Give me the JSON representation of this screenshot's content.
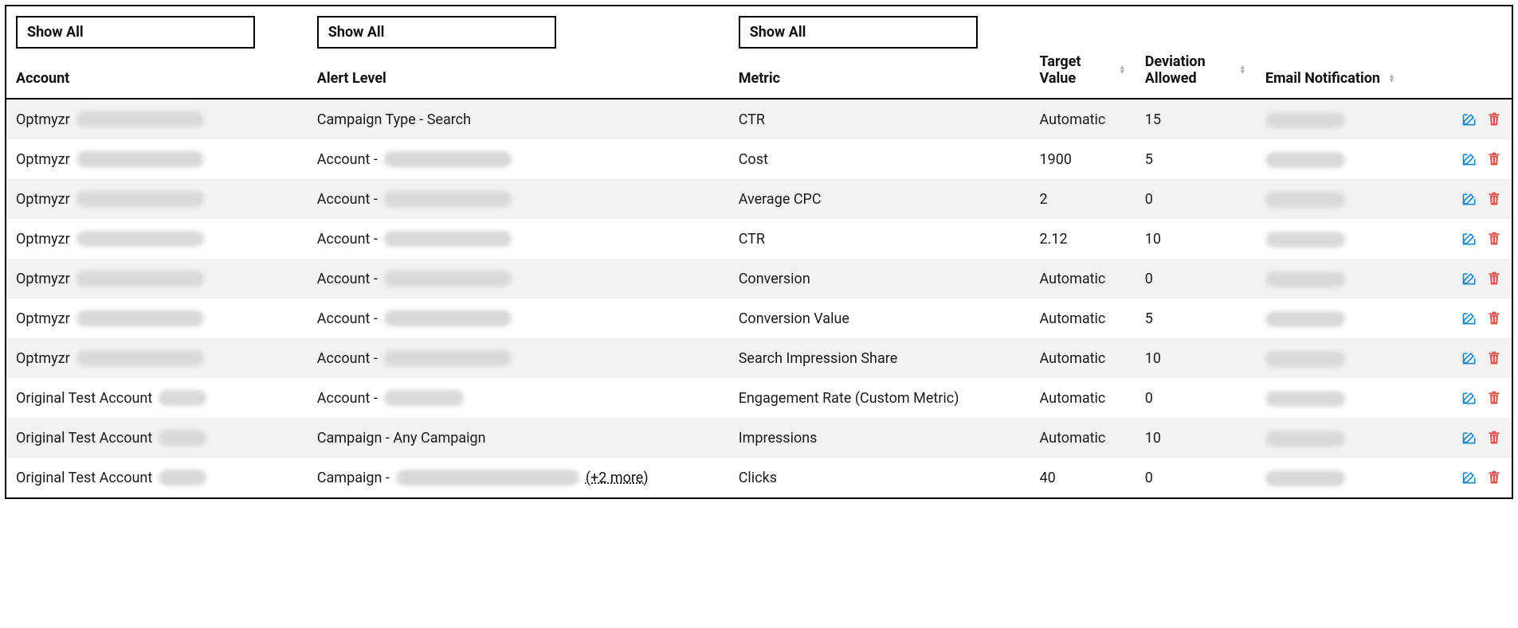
{
  "filters": {
    "account_label": "Show All",
    "alert_label": "Show All",
    "metric_label": "Show All"
  },
  "headers": {
    "account": "Account",
    "alert_level": "Alert Level",
    "metric": "Metric",
    "target_value": "Target Value",
    "deviation_allowed": "Deviation Allowed",
    "email_notification": "Email Notification"
  },
  "rows": [
    {
      "account": "Optmyzr",
      "alert_level_prefix": "Campaign Type - Search",
      "alert_level_blur": false,
      "metric": "CTR",
      "target": "Automatic",
      "deviation": "15"
    },
    {
      "account": "Optmyzr",
      "alert_level_prefix": "Account - ",
      "alert_level_blur": true,
      "metric": "Cost",
      "target": "1900",
      "deviation": "5"
    },
    {
      "account": "Optmyzr",
      "alert_level_prefix": "Account - ",
      "alert_level_blur": true,
      "metric": "Average CPC",
      "target": "2",
      "deviation": "0"
    },
    {
      "account": "Optmyzr",
      "alert_level_prefix": "Account - ",
      "alert_level_blur": true,
      "metric": "CTR",
      "target": "2.12",
      "deviation": "10"
    },
    {
      "account": "Optmyzr",
      "alert_level_prefix": "Account - ",
      "alert_level_blur": true,
      "metric": "Conversion",
      "target": "Automatic",
      "deviation": "0"
    },
    {
      "account": "Optmyzr",
      "alert_level_prefix": "Account - ",
      "alert_level_blur": true,
      "metric": "Conversion Value",
      "target": "Automatic",
      "deviation": "5"
    },
    {
      "account": "Optmyzr",
      "alert_level_prefix": "Account - ",
      "alert_level_blur": true,
      "metric": "Search Impression Share",
      "target": "Automatic",
      "deviation": "10"
    },
    {
      "account": "Original Test Account",
      "alert_level_prefix": "Account - ",
      "alert_level_blur": true,
      "blur_size": "sm",
      "metric": "Engagement Rate (Custom Metric)",
      "target": "Automatic",
      "deviation": "0"
    },
    {
      "account": "Original Test Account",
      "alert_level_prefix": "Campaign - Any Campaign",
      "alert_level_blur": false,
      "metric": "Impressions",
      "target": "Automatic",
      "deviation": "10"
    },
    {
      "account": "Original Test Account",
      "alert_level_prefix": "Campaign - ",
      "alert_level_blur": true,
      "blur_size": "xl",
      "more_text": "(+2 more)",
      "metric": "Clicks",
      "target": "40",
      "deviation": "0"
    }
  ],
  "icons": {
    "edit": "edit-icon",
    "trash": "trash-icon"
  }
}
